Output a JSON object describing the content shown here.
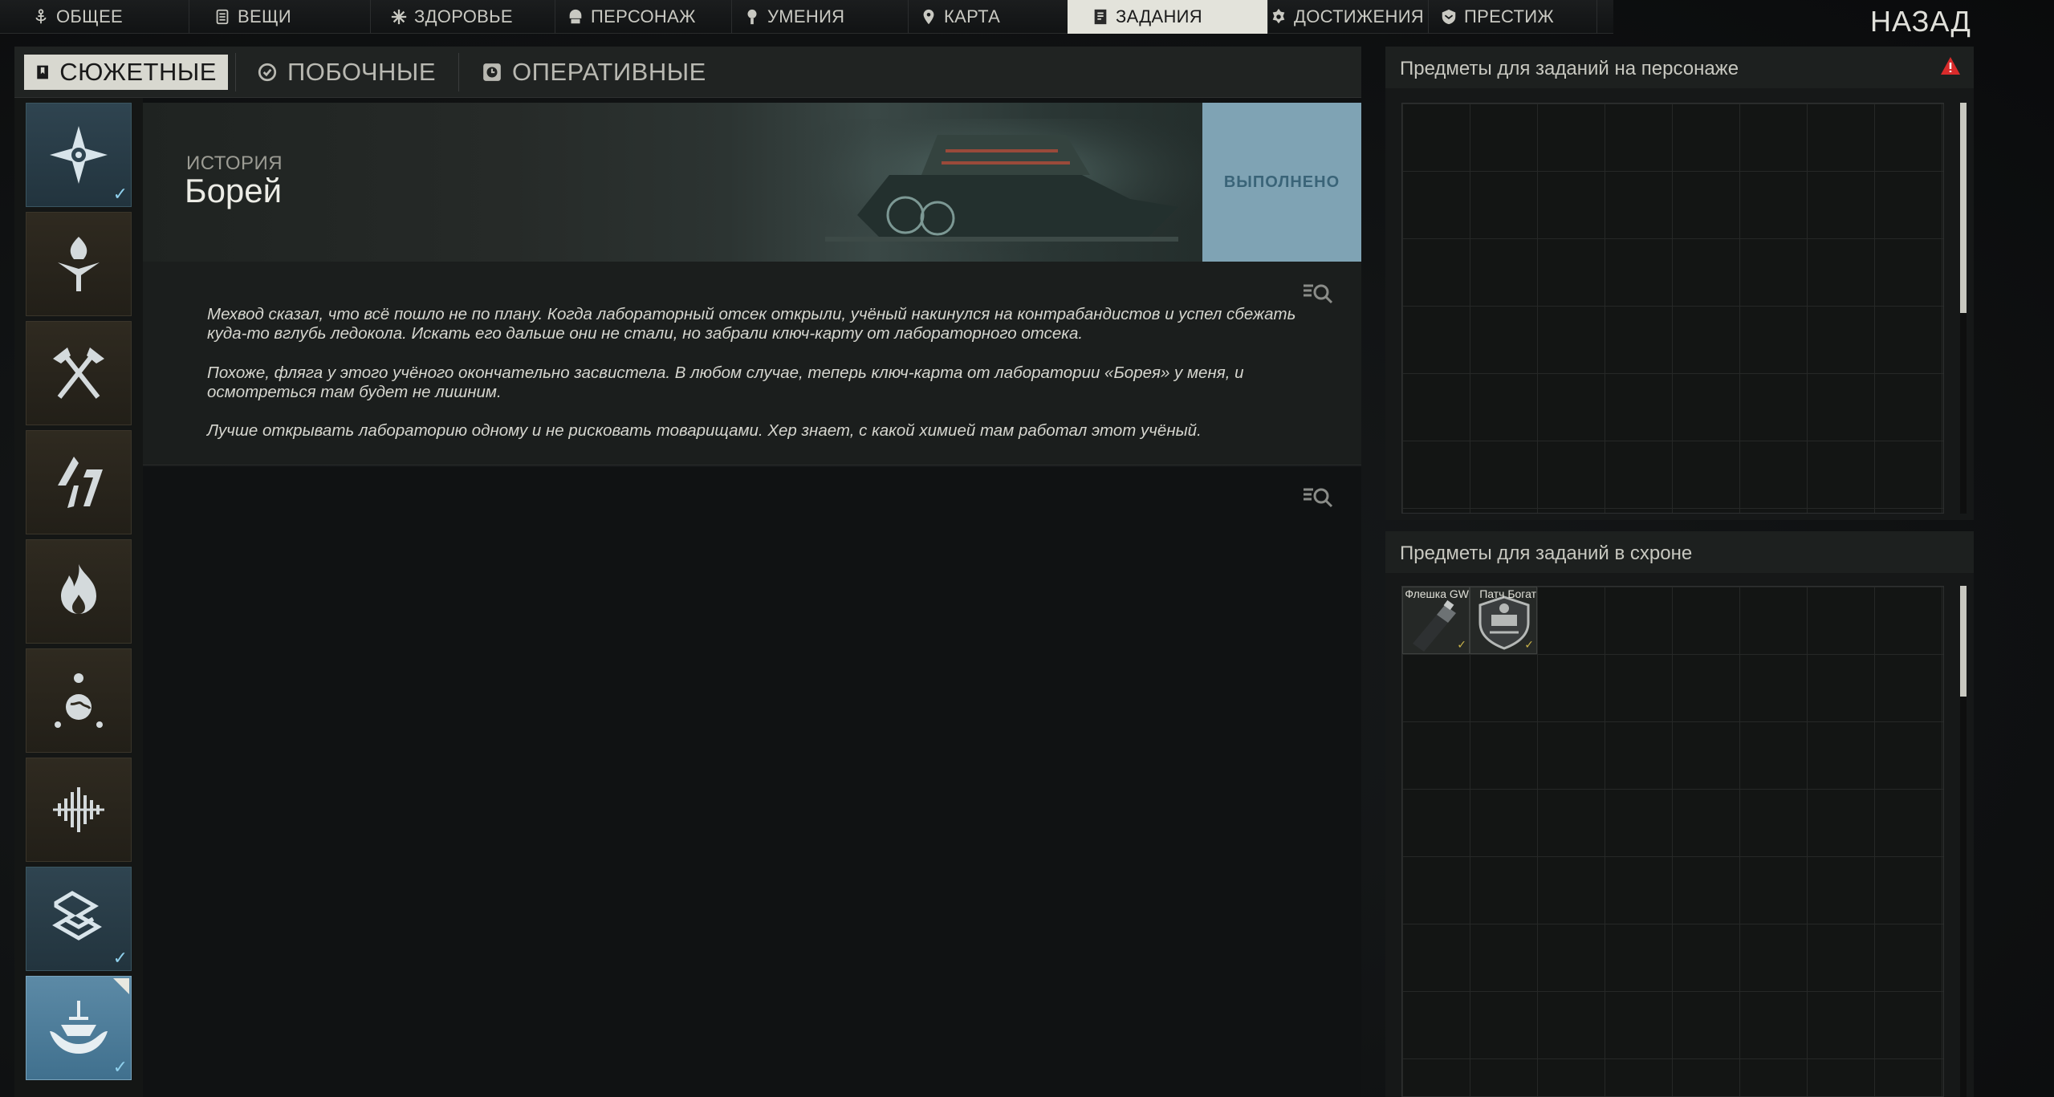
{
  "topnav": {
    "tabs": [
      {
        "label": "ОБЩЕЕ",
        "icon": "anchor-icon"
      },
      {
        "label": "ВЕЩИ",
        "icon": "gear-items-icon"
      },
      {
        "label": "ЗДОРОВЬЕ",
        "icon": "health-icon"
      },
      {
        "label": "ПЕРСОНАЖ",
        "icon": "character-icon"
      },
      {
        "label": "УМЕНИЯ",
        "icon": "skills-icon"
      },
      {
        "label": "КАРТА",
        "icon": "map-pin-icon"
      },
      {
        "label": "ЗАДАНИЯ",
        "icon": "tasks-icon",
        "active": true
      },
      {
        "label": "ДОСТИЖЕНИЯ",
        "icon": "achievements-icon"
      },
      {
        "label": "ПРЕСТИЖ",
        "icon": "prestige-icon"
      }
    ],
    "back_label": "НАЗАД"
  },
  "subtabs": [
    {
      "label": "СЮЖЕТНЫЕ",
      "icon": "bookmark-icon",
      "active": true
    },
    {
      "label": "ПОБОЧНЫЕ",
      "icon": "check-circle-icon"
    },
    {
      "label": "ОПЕРАТИВНЫЕ",
      "icon": "clock-icon"
    }
  ],
  "quests": [
    {
      "icon": "compass-star-icon",
      "completed": true,
      "style": "blue"
    },
    {
      "icon": "torch-icon",
      "completed": false,
      "style": "brown"
    },
    {
      "icon": "crossed-axes-icon",
      "completed": false,
      "style": "brown"
    },
    {
      "icon": "lightning-icon",
      "completed": false,
      "style": "brown"
    },
    {
      "icon": "flame-icon",
      "completed": false,
      "style": "brown"
    },
    {
      "icon": "globe-figure-icon",
      "completed": false,
      "style": "brown"
    },
    {
      "icon": "signal-wave-icon",
      "completed": false,
      "style": "brown"
    },
    {
      "icon": "labyrinth-icon",
      "completed": true,
      "style": "blue"
    },
    {
      "icon": "ship-emblem-icon",
      "completed": true,
      "style": "selected"
    }
  ],
  "quest": {
    "category": "ИСТОРИЯ",
    "title": "Борей",
    "status": "ВЫПОЛНЕНО",
    "description": [
      "Мехвод сказал, что всё пошло не по плану. Когда лабораторный отсек открыли, учёный накинулся на контрабандистов и успел сбежать куда-то вглубь ледокола. Искать его дальше они не стали, но забрали ключ-карту от лабораторного отсека.",
      "Похоже, фляга у этого учёного окончательно засвистела. В любом случае, теперь ключ-карта от лаборатории «Борея» у меня, и осмотреться там будет не лишним.",
      "Лучше открывать лабораторию одному и не рисковать товарищами. Хер знает, с какой химией там работал этот учёный."
    ]
  },
  "panels": {
    "on_character": {
      "title": "Предметы для заданий на персонаже",
      "warning_icon": "warning-icon"
    },
    "in_stash": {
      "title": "Предметы для заданий в схроне",
      "items": [
        {
          "name": "Флешка GW",
          "icon": "usb-drive-icon"
        },
        {
          "name": "Патч Богат",
          "icon": "patch-icon"
        }
      ]
    }
  },
  "colors": {
    "accent": "#7fa3b4",
    "active_tab": "#e3e3db",
    "warning": "#d92b2b"
  }
}
